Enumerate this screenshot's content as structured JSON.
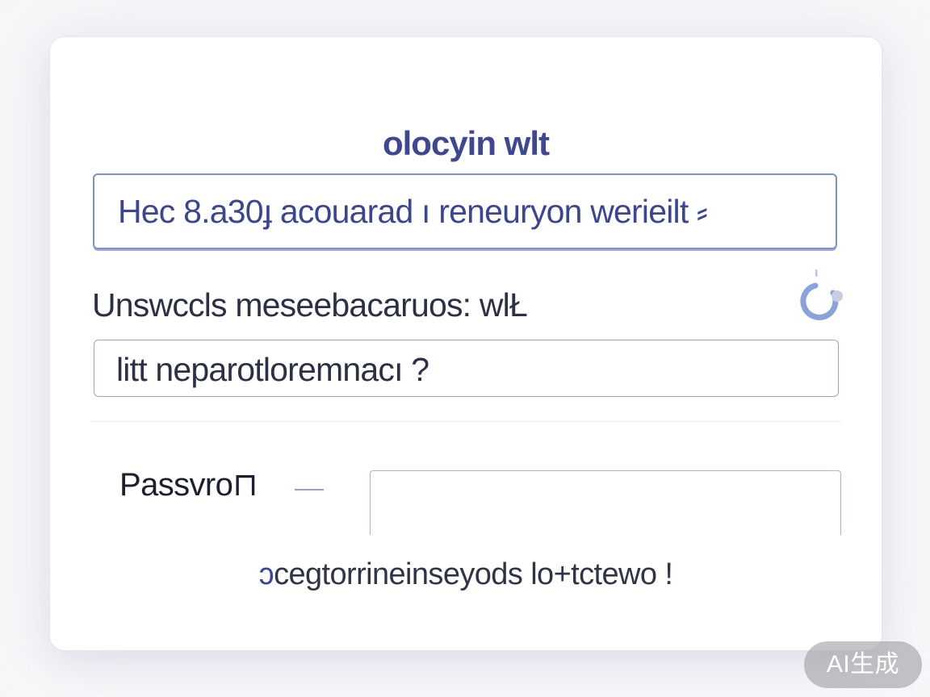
{
  "card": {
    "title": "olocyin wlt",
    "primary_field": {
      "value": "Hec 8.a30ɟ acouarad ı reneuryon werieilt ⸗"
    },
    "field_label": "Unswccls meseebacaruos: wlŁ",
    "secondary_field": {
      "value": "litt neparotloremnacı ?"
    },
    "password": {
      "label": "Passvro⊓",
      "value": ""
    },
    "footer_link": {
      "prefix": "ɔ",
      "text": "cegtorrineinseyods lo+tctewo !"
    }
  },
  "badge": {
    "label": "AI生成"
  },
  "colors": {
    "accent": "#3d4794",
    "field_border": "#7b8fd4",
    "spinner": "#8aa2dc"
  },
  "icons": {
    "loading": "spinner-icon"
  }
}
